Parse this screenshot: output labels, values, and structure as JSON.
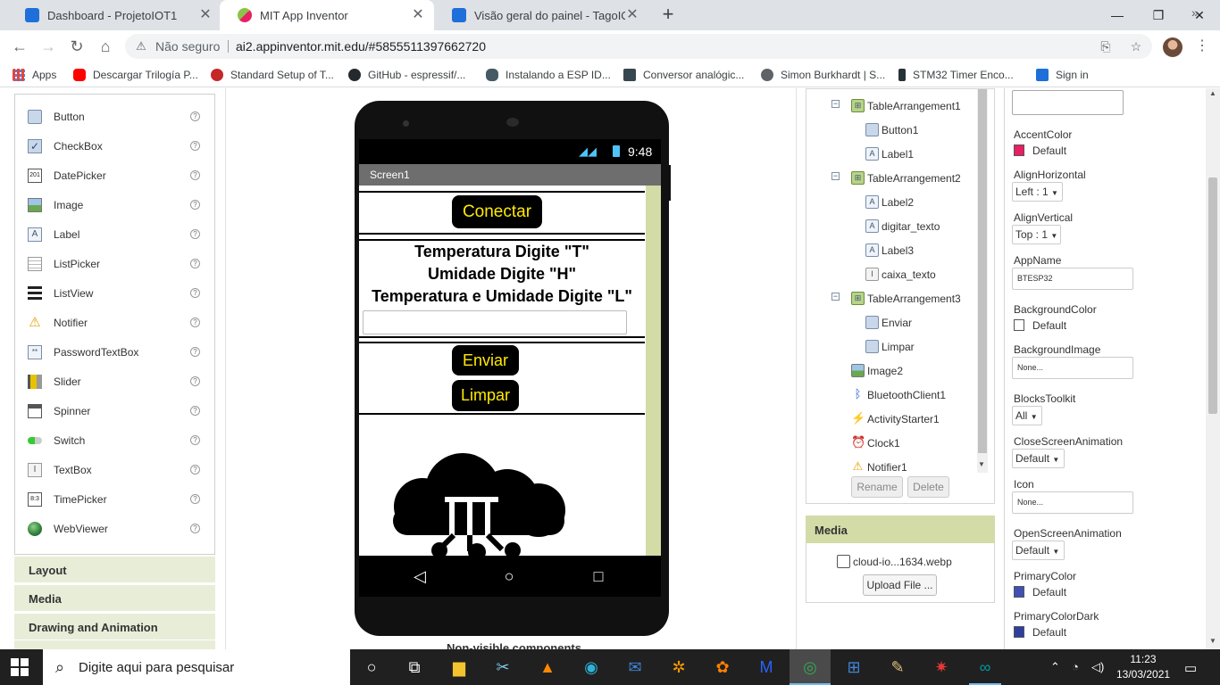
{
  "browser": {
    "tabs": [
      {
        "label": "Dashboard - ProjetoIOT1",
        "close": "✕",
        "fav_color": "#1e6fd9"
      },
      {
        "label": "MIT App Inventor",
        "close": "✕",
        "fav_color": "#8bc34a"
      },
      {
        "label": "Visão geral do painel - TagoIO",
        "close": "✕",
        "fav_color": "#1e6fd9"
      }
    ],
    "new_tab": "+",
    "window_controls": [
      "—",
      "❐",
      "✕"
    ],
    "omnibox": {
      "security_label": "Não seguro",
      "url": "ai2.appinventor.mit.edu/#5855511397662720"
    },
    "bookmarks": [
      {
        "label": "Apps",
        "icon": "apps-grid-icon"
      },
      {
        "label": "Descargar Trilogía P...",
        "icon": "youtube-icon"
      },
      {
        "label": "Standard Setup of T...",
        "icon": "globe-red-icon"
      },
      {
        "label": "GitHub - espressif/...",
        "icon": "github-icon"
      },
      {
        "label": "Instalando a ESP ID...",
        "icon": "bike-icon"
      },
      {
        "label": "Conversor analógic...",
        "icon": "grid-icon"
      },
      {
        "label": "Simon Burkhardt | S...",
        "icon": "globe-icon"
      },
      {
        "label": "STM32 Timer Enco...",
        "icon": "chip-icon"
      },
      {
        "label": "Sign in",
        "icon": "tago-icon"
      }
    ],
    "bookmarks_more": "»"
  },
  "palette": {
    "items": [
      {
        "label": "Button",
        "icon": "button-icon"
      },
      {
        "label": "CheckBox",
        "icon": "checkbox-icon"
      },
      {
        "label": "DatePicker",
        "icon": "datepicker-icon"
      },
      {
        "label": "Image",
        "icon": "image-icon"
      },
      {
        "label": "Label",
        "icon": "label-icon"
      },
      {
        "label": "ListPicker",
        "icon": "listpicker-icon"
      },
      {
        "label": "ListView",
        "icon": "listview-icon"
      },
      {
        "label": "Notifier",
        "icon": "notifier-icon"
      },
      {
        "label": "PasswordTextBox",
        "icon": "password-icon"
      },
      {
        "label": "Slider",
        "icon": "slider-icon"
      },
      {
        "label": "Spinner",
        "icon": "spinner-icon"
      },
      {
        "label": "Switch",
        "icon": "switch-icon"
      },
      {
        "label": "TextBox",
        "icon": "textbox-icon"
      },
      {
        "label": "TimePicker",
        "icon": "timepicker-icon"
      },
      {
        "label": "WebViewer",
        "icon": "webviewer-icon"
      }
    ],
    "help": "?",
    "categories": [
      "Layout",
      "Media",
      "Drawing and Animation"
    ]
  },
  "viewer": {
    "status_time": "9:48",
    "screen_title": "Screen1",
    "connect_button": "Conectar",
    "info_lines": [
      "Temperatura Digite \"T\"",
      "Umidade Digite \"H\"",
      "Temperatura e Umidade Digite \"L\""
    ],
    "send_button": "Enviar",
    "clear_button": "Limpar",
    "nav": {
      "back": "◁",
      "home": "○",
      "recent": "□"
    },
    "non_visible_label": "Non-visible components"
  },
  "components": {
    "tree": [
      {
        "label": "TableArrangement1",
        "icon": "arrangement-icon",
        "level": 1,
        "toggle": "−"
      },
      {
        "label": "Button1",
        "icon": "button-icon",
        "level": 2
      },
      {
        "label": "Label1",
        "icon": "label-icon",
        "level": 2
      },
      {
        "label": "TableArrangement2",
        "icon": "arrangement-icon",
        "level": 1,
        "toggle": "−"
      },
      {
        "label": "Label2",
        "icon": "label-icon",
        "level": 2
      },
      {
        "label": "digitar_texto",
        "icon": "label-icon",
        "level": 2
      },
      {
        "label": "Label3",
        "icon": "label-icon",
        "level": 2
      },
      {
        "label": "caixa_texto",
        "icon": "textbox-icon",
        "level": 2
      },
      {
        "label": "TableArrangement3",
        "icon": "arrangement-icon",
        "level": 1,
        "toggle": "−"
      },
      {
        "label": "Enviar",
        "icon": "button-icon",
        "level": 2
      },
      {
        "label": "Limpar",
        "icon": "button-icon",
        "level": 2
      },
      {
        "label": "Image2",
        "icon": "image-icon",
        "level": 1
      },
      {
        "label": "BluetoothClient1",
        "icon": "bluetooth-icon",
        "level": 1
      },
      {
        "label": "ActivityStarter1",
        "icon": "activity-icon",
        "level": 1
      },
      {
        "label": "Clock1",
        "icon": "clock-icon",
        "level": 1
      },
      {
        "label": "Notifier1",
        "icon": "notifier-icon",
        "level": 1
      }
    ],
    "rename_button": "Rename",
    "delete_button": "Delete"
  },
  "media": {
    "title": "Media",
    "file": "cloud-io...1634.webp",
    "upload_button": "Upload File ..."
  },
  "properties": {
    "accent_color": {
      "name": "AccentColor",
      "value": "Default",
      "swatch": "#e91e63"
    },
    "align_horizontal": {
      "name": "AlignHorizontal",
      "value": "Left : 1"
    },
    "align_vertical": {
      "name": "AlignVertical",
      "value": "Top : 1"
    },
    "app_name": {
      "name": "AppName",
      "value": "BTESP32"
    },
    "background_color": {
      "name": "BackgroundColor",
      "value": "Default",
      "swatch": "#ffffff"
    },
    "background_image": {
      "name": "BackgroundImage",
      "value": "None..."
    },
    "blocks_toolkit": {
      "name": "BlocksToolkit",
      "value": "All"
    },
    "close_screen_animation": {
      "name": "CloseScreenAnimation",
      "value": "Default"
    },
    "icon": {
      "name": "Icon",
      "value": "None..."
    },
    "open_screen_animation": {
      "name": "OpenScreenAnimation",
      "value": "Default"
    },
    "primary_color": {
      "name": "PrimaryColor",
      "value": "Default",
      "swatch": "#3f51b5"
    },
    "primary_color_dark": {
      "name": "PrimaryColorDark",
      "value": "Default",
      "swatch": "#303f9f"
    }
  },
  "taskbar": {
    "search_placeholder": "Digite aqui para pesquisar",
    "time": "11:23",
    "date": "13/03/2021"
  }
}
